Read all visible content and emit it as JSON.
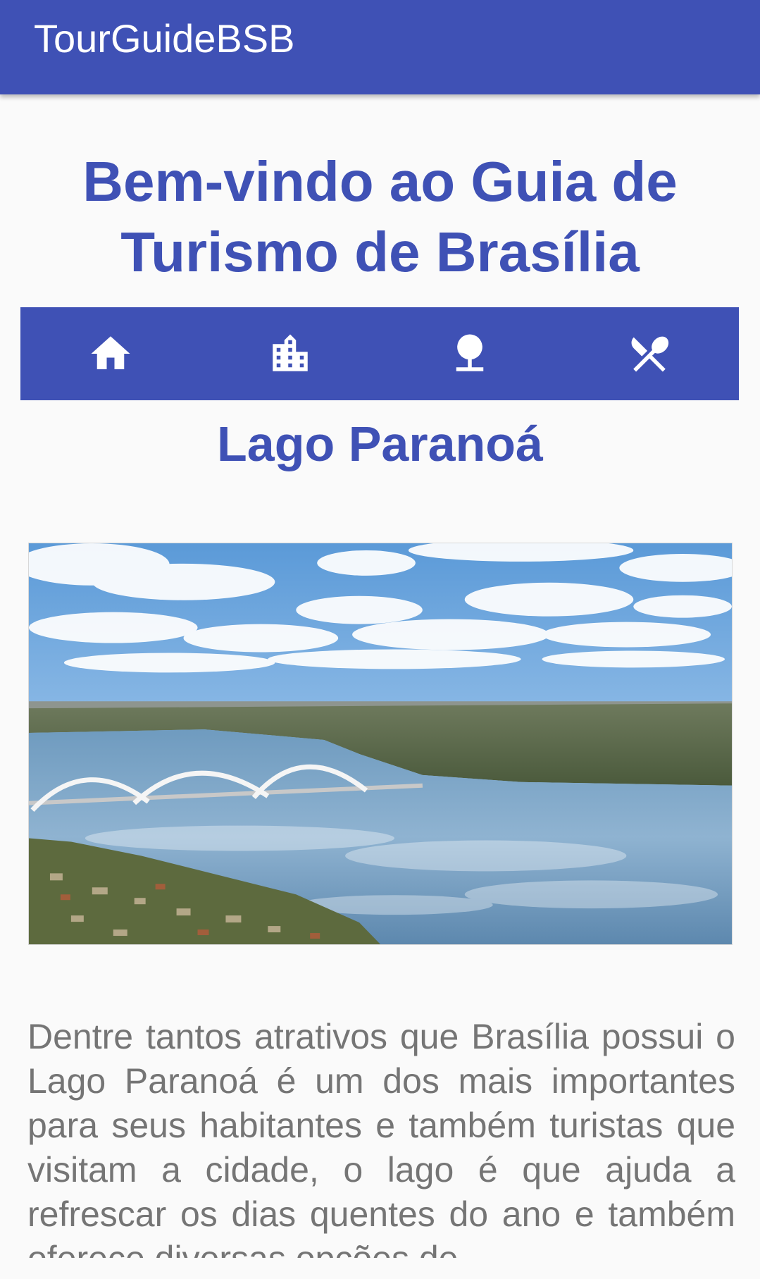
{
  "app": {
    "title": "TourGuideBSB"
  },
  "welcome": {
    "heading": "Bem-vindo ao Guia de Turismo de Brasília"
  },
  "tabs": [
    {
      "icon": "home-icon"
    },
    {
      "icon": "city-buildings-icon"
    },
    {
      "icon": "park-tree-icon"
    },
    {
      "icon": "restaurant-utensils-icon"
    }
  ],
  "attraction": {
    "title": "Lago Paranoá",
    "description": "Dentre tantos atrativos que Brasília possui o Lago Paranoá é um dos mais importantes para seus habitantes e também turistas que visitam a cidade, o lago é que ajuda a refrescar os dias quentes do ano e também oferece diversas opções de"
  },
  "colors": {
    "primary": "#3f51b5",
    "background": "#fafafa",
    "body_text": "#757575"
  }
}
